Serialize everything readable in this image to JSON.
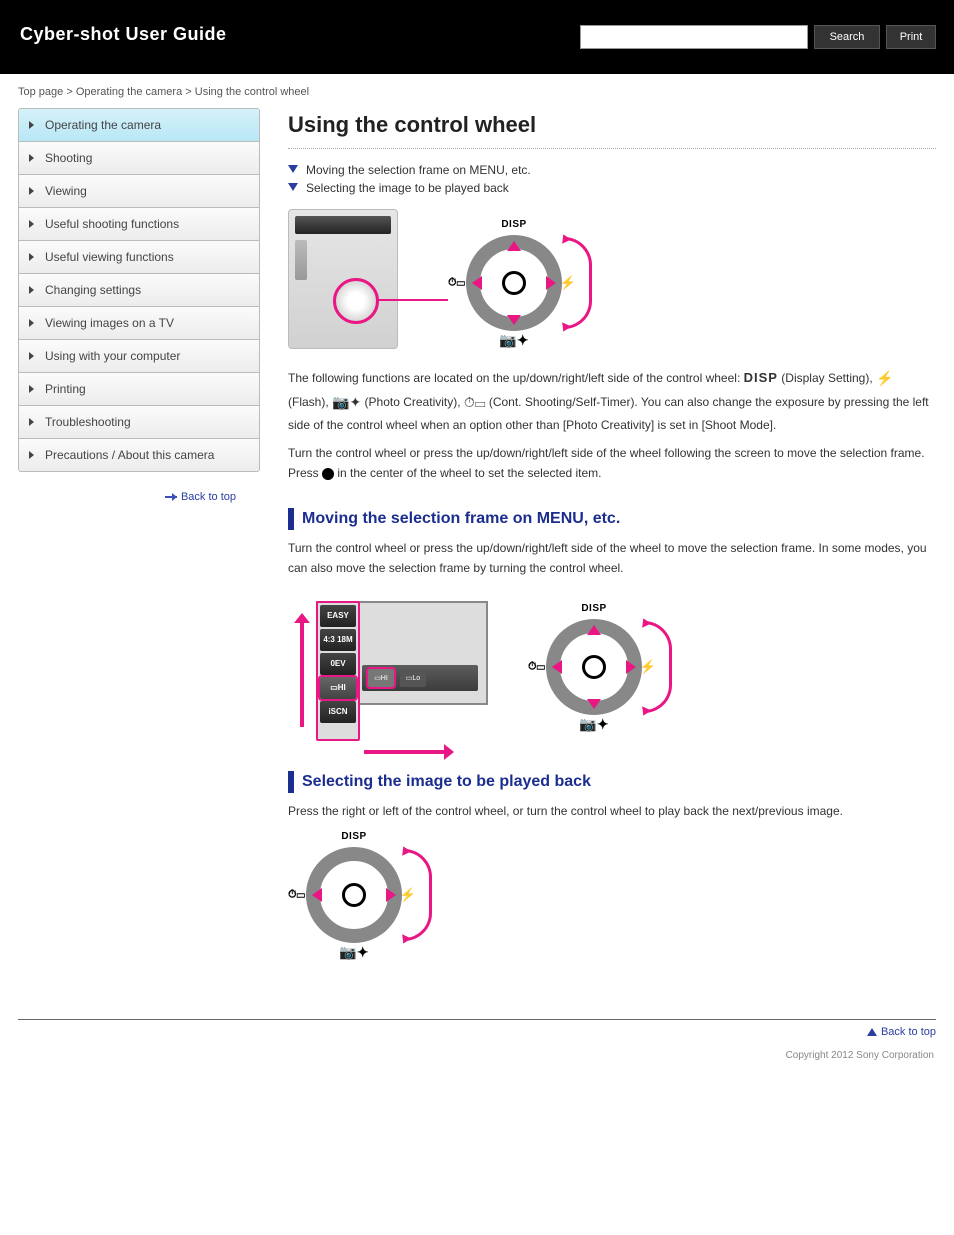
{
  "topbar": {
    "title": "Cyber-shot User Guide",
    "search_placeholder": "",
    "btn_search": "Search",
    "btn_print": "Print"
  },
  "breadcrumb": {
    "top": "Top page",
    "sec": "Operating the camera",
    "cur": "Using the control wheel"
  },
  "sidebar": {
    "items": [
      "Operating the camera",
      "Shooting",
      "Viewing",
      "Useful shooting functions",
      "Useful viewing functions",
      "Changing settings",
      "Viewing images on a TV",
      "Using with your computer",
      "Printing",
      "Troubleshooting",
      "Precautions / About this camera"
    ],
    "back": "Back to top"
  },
  "main": {
    "title": "Using the control wheel",
    "jump1": "Moving the selection frame on MENU, etc.",
    "jump2": "Selecting the image to be played back",
    "para1_a": "The following functions are located on the up/down/right/left side of the control wheel: ",
    "para1_b": " (Display Setting), ",
    "para1_c": " (Flash), ",
    "para1_d": " (Photo Creativity), ",
    "para1_e": " (Cont. Shooting/Self-Timer). You can also change the exposure by pressing the left side of the control wheel when an option other than [Photo Creativity] is set in [Shoot Mode].",
    "para2": "Turn the control wheel or press the up/down/right/left side of the wheel following the screen to move the selection frame. Press ",
    "para2b": " in the center of the wheel to set the selected item.",
    "lbl_disp": "DISP",
    "lbl_flash": "⚡",
    "lbl_creativity": "📷✦",
    "lbl_timer": "⏱▭",
    "h2a": "Moving the selection frame on MENU, etc.",
    "para3": "Turn the control wheel or press the up/down/right/left side of the wheel to move the selection frame. In some modes, you can also move the selection frame by turning the control wheel.",
    "menu_items": [
      "EASY",
      "4:3 18M",
      "0EV",
      "▭HI",
      "iSCN",
      "▾"
    ],
    "menu_row": [
      "▭HI",
      "▭Lo"
    ],
    "h2b": "Selecting the image to be played back",
    "para4": "Press the right or left of the control wheel, or turn the control wheel to play back the next/previous image.",
    "backtop": "Back to top"
  },
  "footer": {
    "copyright": "Copyright 2012 Sony Corporation"
  }
}
